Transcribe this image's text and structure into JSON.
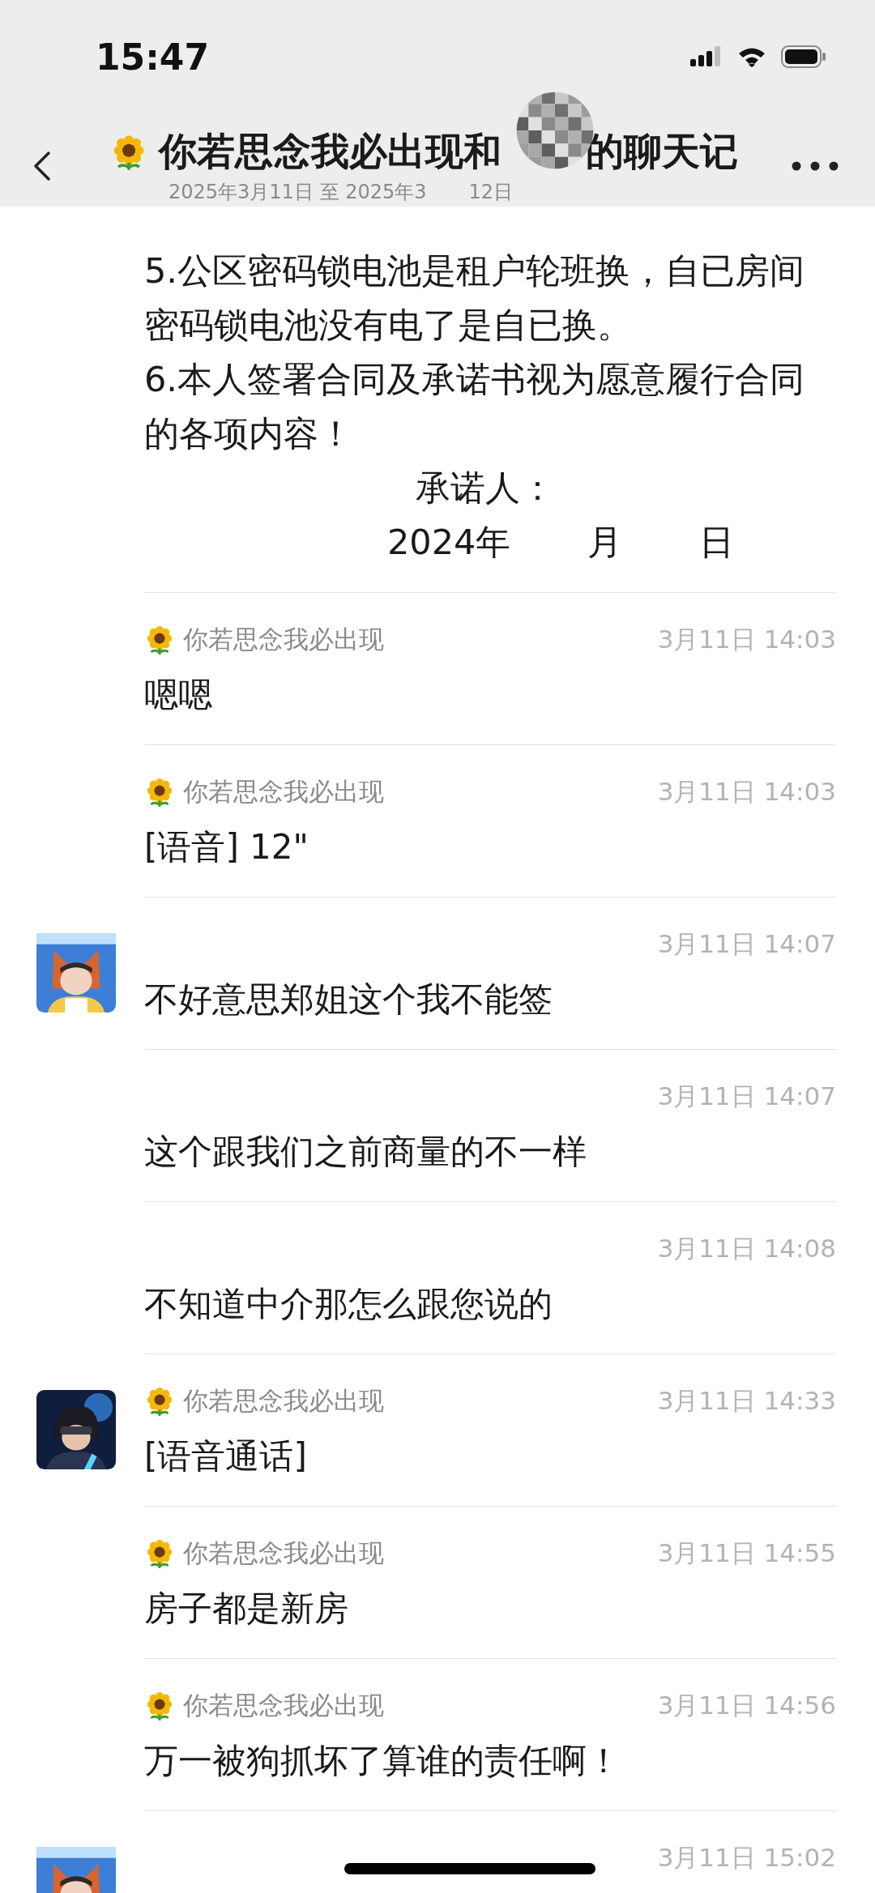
{
  "status_bar": {
    "time": "15:47"
  },
  "header": {
    "title_parts": [
      "你若思念我必出现和",
      "的聊天记"
    ],
    "subtitle_parts": [
      "2025年3月11日 至 2025年3",
      "12日"
    ]
  },
  "document": {
    "lines": [
      {
        "kind": "text",
        "parts": [
          "5.公区密码锁电池是租户轮班换，自已房间"
        ]
      },
      {
        "kind": "text",
        "parts": [
          "密码锁电池没有电了是自已换。"
        ]
      },
      {
        "kind": "text",
        "parts": [
          "6.本人签署合同及承诺书视为愿意履行合同"
        ]
      },
      {
        "kind": "text",
        "parts": [
          "的各项内容！"
        ]
      },
      {
        "kind": "signer",
        "parts": [
          "承诺人："
        ]
      },
      {
        "kind": "date",
        "parts": [
          "2024年",
          "月",
          "日"
        ]
      }
    ]
  },
  "messages": [
    {
      "sender": "你若思念我必出现",
      "time": "3月11日 14:03",
      "text": "嗯嗯"
    },
    {
      "sender": "你若思念我必出现",
      "time": "3月11日 14:03",
      "text": "[语音] 12\""
    },
    {
      "time": "3月11日 14:07",
      "text": "不好意思郑姐这个我不能签"
    },
    {
      "time": "3月11日 14:07",
      "text": "这个跟我们之前商量的不一样"
    },
    {
      "time": "3月11日 14:08",
      "text": "不知道中介那怎么跟您说的"
    },
    {
      "sender": "你若思念我必出现",
      "time": "3月11日 14:33",
      "text": "[语音通话]"
    },
    {
      "sender": "你若思念我必出现",
      "time": "3月11日 14:55",
      "text": "房子都是新房"
    },
    {
      "sender": "你若思念我必出现",
      "time": "3月11日 14:56",
      "text": "万一被狗抓坏了算谁的责任啊！"
    },
    {
      "time": "3月11日 15:02"
    }
  ]
}
